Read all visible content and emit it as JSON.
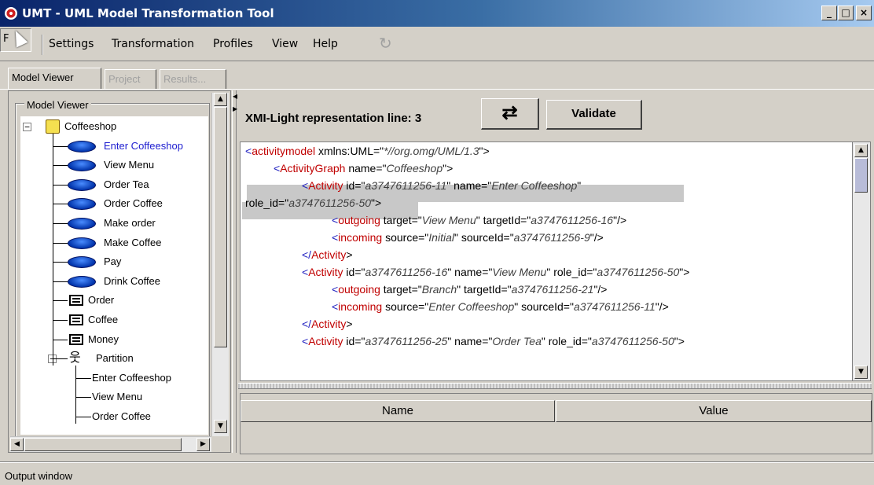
{
  "window": {
    "title": "UMT - UML Model Transformation Tool",
    "min_label": "_",
    "max_label": "□",
    "close_label": "×"
  },
  "menu": {
    "file": "F",
    "items": [
      "Settings",
      "Transformation",
      "Profiles",
      "View",
      "Help"
    ]
  },
  "tabs": [
    {
      "label": "Model Viewer",
      "active": true
    },
    {
      "label": "Project",
      "active": false
    },
    {
      "label": "Results...",
      "active": false
    }
  ],
  "model_viewer": {
    "group_label": "Model Viewer",
    "tree": [
      {
        "label": "Coffeeshop",
        "icon": "package-icon",
        "level": 0
      },
      {
        "label": "Enter Coffeeshop",
        "icon": "activity-icon",
        "level": 1,
        "selected": true
      },
      {
        "label": "View Menu",
        "icon": "activity-icon",
        "level": 1
      },
      {
        "label": "Order Tea",
        "icon": "activity-icon",
        "level": 1
      },
      {
        "label": "Order Coffee",
        "icon": "activity-icon",
        "level": 1
      },
      {
        "label": "Make order",
        "icon": "activity-icon",
        "level": 1
      },
      {
        "label": "Make Coffee",
        "icon": "activity-icon",
        "level": 1
      },
      {
        "label": "Pay",
        "icon": "activity-icon",
        "level": 1
      },
      {
        "label": "Drink Coffee",
        "icon": "activity-icon",
        "level": 1
      },
      {
        "label": "Order",
        "icon": "class-icon",
        "level": 1
      },
      {
        "label": "Coffee",
        "icon": "class-icon",
        "level": 1
      },
      {
        "label": "Money",
        "icon": "class-icon",
        "level": 1
      },
      {
        "label": "Partition",
        "icon": "actor-icon",
        "level": 1
      },
      {
        "label": "Enter Coffeeshop",
        "icon": "none",
        "level": 2
      },
      {
        "label": "View Menu",
        "icon": "none",
        "level": 2
      },
      {
        "label": "Order Coffee",
        "icon": "none",
        "level": 2
      }
    ]
  },
  "xmi": {
    "label": "XMI-Light representation  line: 3",
    "swap_icon": "⇄",
    "validate_label": "Validate",
    "lines": [
      {
        "open": "<",
        "tag": "activitymodel",
        "rest": " xmlns:UML=\"",
        "val": "*//org.omg/UML/1.3",
        "tail": "\">"
      },
      {
        "open": "<",
        "tag": "ActivityGraph",
        "rest": " name=\"",
        "val": "Coffeeshop",
        "tail": "\">"
      },
      {
        "open": "<",
        "tag": "Activity",
        "rest": " id=\"",
        "val": "a3747611256-11",
        "tail": "\" name=\"",
        "val2": "Enter Coffeeshop",
        "tail2": "\""
      },
      {
        "open": "",
        "tag": "",
        "rest": "role_id=\"",
        "val": "a3747611256-50",
        "tail": "\">"
      },
      {
        "open": "<",
        "tag": "outgoing",
        "rest": " target=\"",
        "val": "View Menu",
        "tail": "\" targetId=\"",
        "val2": "a3747611256-16",
        "tail2": "\"/>"
      },
      {
        "open": "<",
        "tag": "incoming",
        "rest": " source=\"",
        "val": "Initial",
        "tail": "\" sourceId=\"",
        "val2": "a3747611256-9",
        "tail2": "\"/>"
      },
      {
        "open": "</",
        "tag": "Activity",
        "rest": "",
        "val": "",
        "tail": ">"
      },
      {
        "open": "<",
        "tag": "Activity",
        "rest": " id=\"",
        "val": "a3747611256-16",
        "tail": "\" name=\"",
        "val2": "View Menu",
        "tail2": "\" role_id=\"",
        "val3": "a3747611256-50",
        "tail3": "\">"
      },
      {
        "open": "<",
        "tag": "outgoing",
        "rest": " target=\"",
        "val": "Branch",
        "tail": "\" targetId=\"",
        "val2": "a3747611256-21",
        "tail2": "\"/>"
      },
      {
        "open": "<",
        "tag": "incoming",
        "rest": " source=\"",
        "val": "Enter Coffeeshop",
        "tail": "\" sourceId=\"",
        "val2": "a3747611256-11",
        "tail2": "\"/>"
      },
      {
        "open": "</",
        "tag": "Activity",
        "rest": "",
        "val": "",
        "tail": ">"
      },
      {
        "open": "<",
        "tag": "Activity",
        "rest": " id=\"",
        "val": "a3747611256-25",
        "tail": "\" name=\"",
        "val2": "Order Tea",
        "tail2": "\" role_id=\"",
        "val3": "a3747611256-50",
        "tail3": "\">"
      }
    ]
  },
  "properties_table": {
    "columns": [
      "Name",
      "Value"
    ]
  },
  "status": "Output window",
  "colors": {
    "titlebar_start": "#0a246a",
    "titlebar_end": "#a6caf0",
    "tag_red": "#c00000",
    "angle_blue": "#2020c0",
    "highlight_gray": "#c8c8c8",
    "selected_blue": "#2020d0"
  }
}
